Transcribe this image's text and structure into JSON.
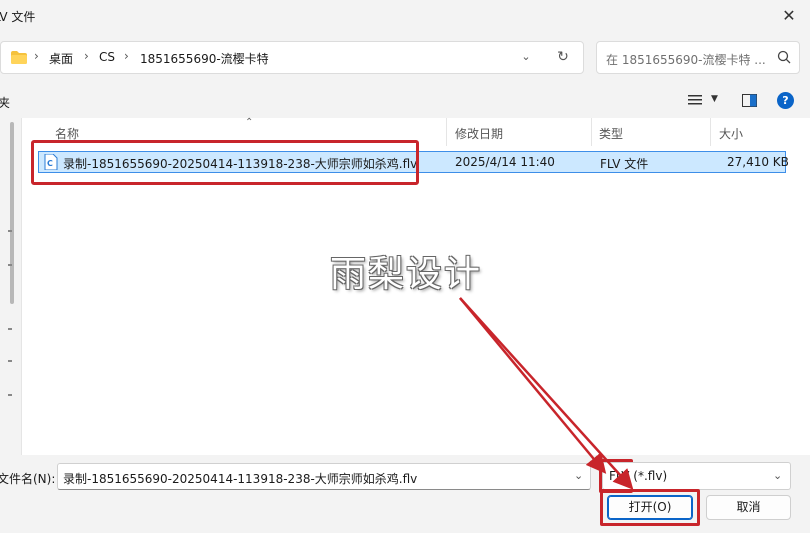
{
  "window": {
    "title": "LV 文件",
    "close_glyph": "✕"
  },
  "address": {
    "crumbs": [
      "桌面",
      "CS",
      "1851655690-流樱卡特"
    ],
    "folder_icon": "folder-icon",
    "refresh_icon": "refresh-icon"
  },
  "search": {
    "placeholder": "在 1851655690-流樱卡特 ..."
  },
  "toolbar": {
    "left_text": "夹"
  },
  "columns": {
    "name": "名称",
    "modified": "修改日期",
    "type": "类型",
    "size": "大小"
  },
  "files": [
    {
      "name": "录制-1851655690-20250414-113918-238-大师宗师如杀鸡.flv",
      "modified": "2025/4/14 11:40",
      "type": "FLV 文件",
      "size": "27,410 KB"
    }
  ],
  "watermark": "雨梨设计",
  "bottom": {
    "filename_label": "文件名(N):",
    "filename_value": "录制-1851655690-20250414-113918-238-大师宗师如杀鸡.flv",
    "filetype_value": "FLV (*.flv)",
    "open_label": "打开(O)",
    "cancel_label": "取消"
  },
  "colors": {
    "accent": "#0a64c8",
    "selection": "#cce8ff",
    "annotation": "#c8252b"
  }
}
